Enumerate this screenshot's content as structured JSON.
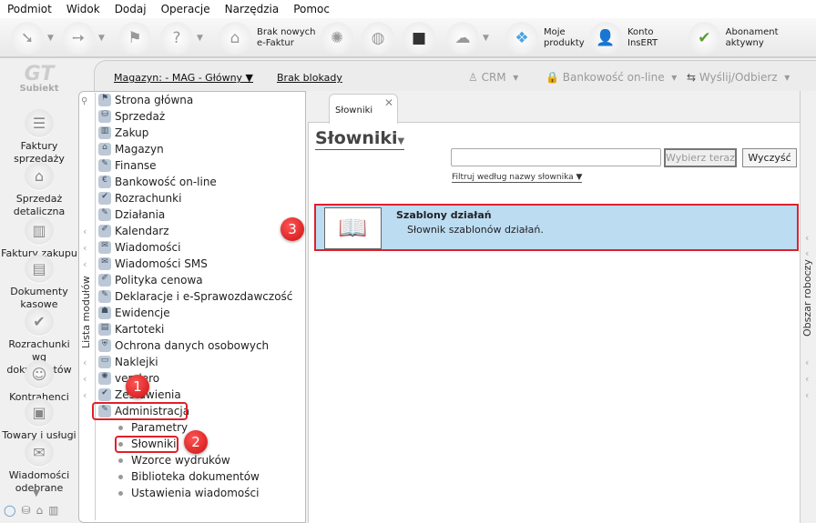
{
  "menu": [
    "Podmiot",
    "Widok",
    "Dodaj",
    "Operacje",
    "Narzędzia",
    "Pomoc"
  ],
  "toolbar": {
    "ksef_label_1": "Brak nowych",
    "ksef_label_2": "e-Faktur",
    "products_1": "Moje",
    "products_2": "produkty",
    "account_1": "Konto",
    "account_2": "InsERT",
    "subscription": "Abonament aktywny"
  },
  "secbar": {
    "warehouse": "Magazyn: - MAG - Główny",
    "lock": "Brak blokady",
    "crm": "CRM",
    "banking": "Bankowość on-line",
    "send": "Wyślij/Odbierz"
  },
  "app_logo": "Subiekt",
  "leftnav": [
    {
      "label": "Faktury sprzedaży"
    },
    {
      "label": "Sprzedaż detaliczna"
    },
    {
      "label": "Faktury zakupu"
    },
    {
      "label": "Dokumenty kasowe"
    },
    {
      "label": "Rozrachunki wg dokumentów"
    },
    {
      "label": "Kontrahenci"
    },
    {
      "label": "Towary i usługi"
    },
    {
      "label": "Wiadomości odebrane"
    }
  ],
  "module_list_label": "Lista modułów",
  "modules": [
    "Strona główna",
    "Sprzedaż",
    "Zakup",
    "Magazyn",
    "Finanse",
    "Bankowość on-line",
    "Rozrachunki",
    "Działania",
    "Kalendarz",
    "Wiadomości",
    "Wiadomości SMS",
    "Polityka cenowa",
    "Deklaracje i e-Sprawozdawczość",
    "Ewidencje",
    "Kartoteki",
    "Ochrona danych osobowych",
    "Naklejki",
    "vendero",
    "Zestawienia",
    "Administracja"
  ],
  "admin_sub": [
    "Parametry",
    "Słowniki",
    "Wzorce wydruków",
    "Biblioteka dokumentów",
    "Ustawienia wiadomości"
  ],
  "badges": [
    "1",
    "2",
    "3"
  ],
  "main": {
    "tab": "Słowniki",
    "title": "Słowniki",
    "search_value": "",
    "select_now": "Wybierz teraz",
    "clear": "Wyczyść",
    "filter": "Filtruj według nazwy słownika",
    "items": [
      {
        "name": "Szablony działań",
        "desc": "Słownik szablonów działań."
      }
    ]
  },
  "workspace_label": "Obszar roboczy",
  "colors": {
    "highlight": "#bcdcf2",
    "annotation": "#e0202a"
  }
}
